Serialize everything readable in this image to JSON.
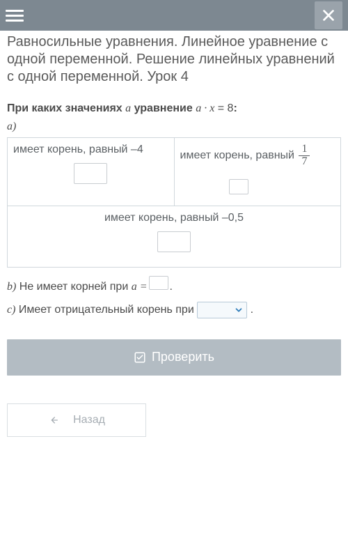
{
  "title": "Равносильные уравнения. Линейное уравнение с одной переменной. Решение линейных уравнений с одной переменной. Урок 4",
  "question": {
    "pre": "При каких значениях",
    "var": "a",
    "mid": "уравнение",
    "eq_lhs": "a · x",
    "eq_rhs": "8",
    "colon": ":"
  },
  "part_a": {
    "label": "a)",
    "cell1": "имеет корень, равный –4",
    "cell2_text": "имеет корень, равный",
    "cell2_frac_num": "1",
    "cell2_frac_den": "7",
    "cell3": "имеет корень, равный –0,5"
  },
  "part_b": {
    "label": "b)",
    "text_pre": "Не имеет корней при",
    "var": "a =",
    "period": "."
  },
  "part_c": {
    "label": "c)",
    "text": "Имеет отрицательный корень при",
    "period": "."
  },
  "buttons": {
    "check": "Проверить",
    "back": "Назад"
  }
}
